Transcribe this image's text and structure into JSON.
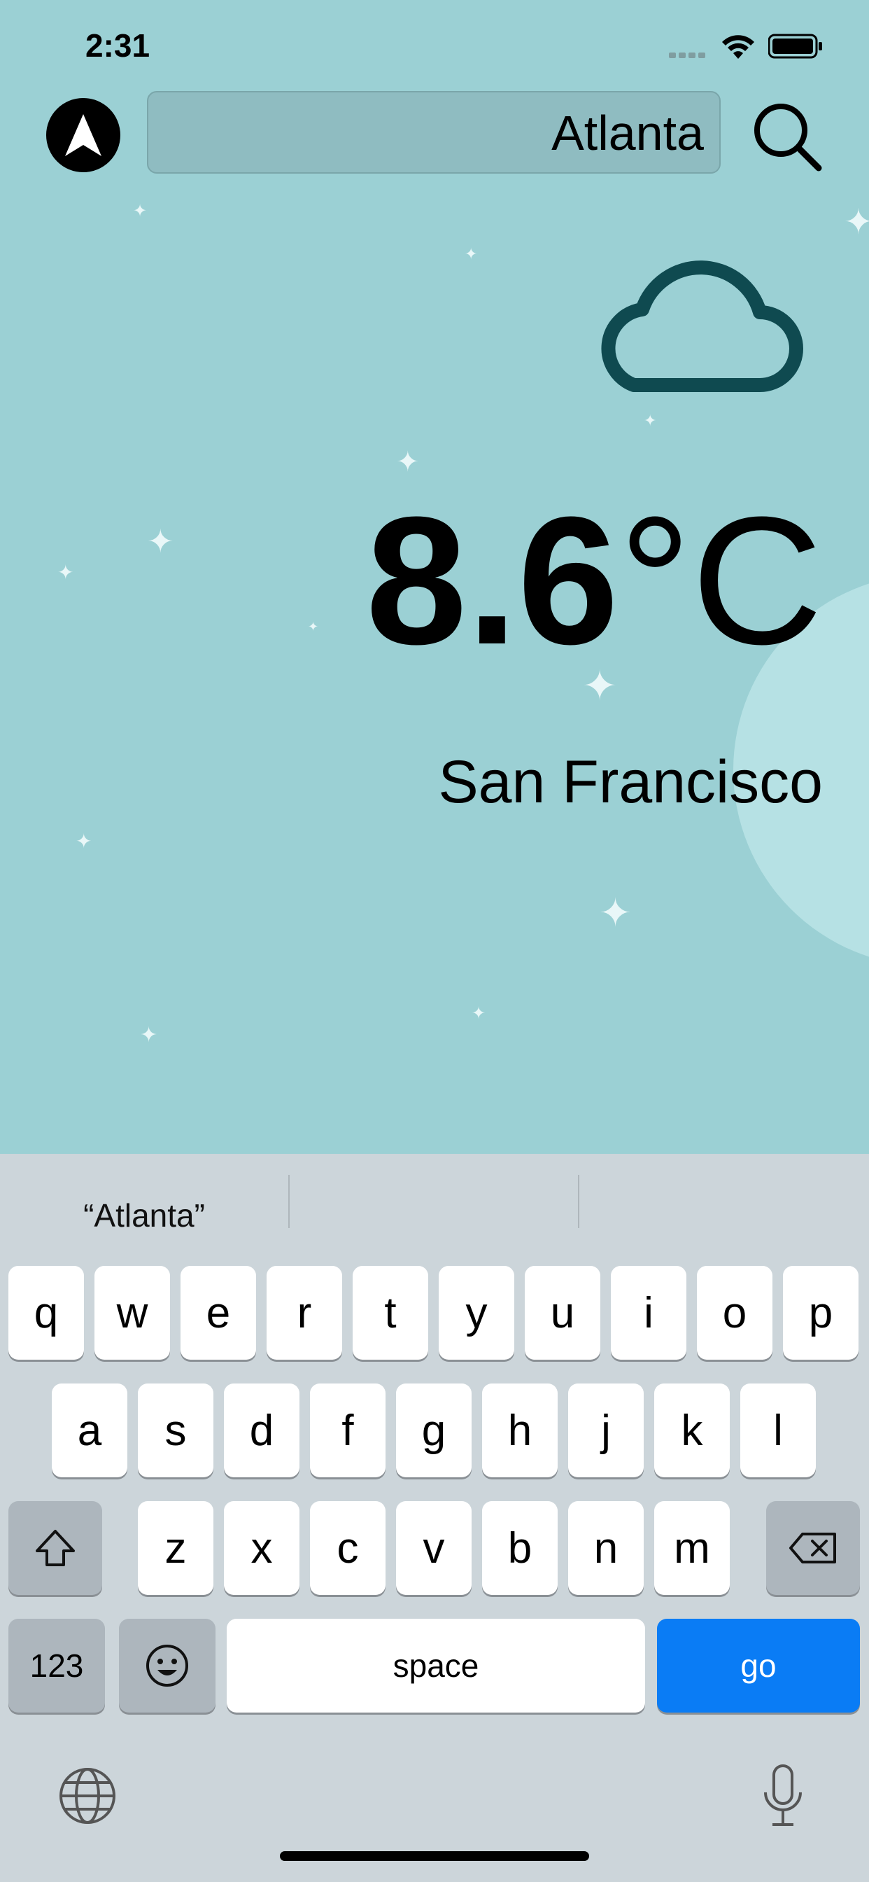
{
  "status_bar": {
    "time": "2:31"
  },
  "search": {
    "value": "Atlanta"
  },
  "weather": {
    "icon": "cloud-icon",
    "temp_value": "8.6",
    "temp_unit": "°C",
    "city": "San Francisco"
  },
  "keyboard": {
    "suggestions": [
      "“Atlanta”",
      "",
      ""
    ],
    "rows": [
      [
        "q",
        "w",
        "e",
        "r",
        "t",
        "y",
        "u",
        "i",
        "o",
        "p"
      ],
      [
        "a",
        "s",
        "d",
        "f",
        "g",
        "h",
        "j",
        "k",
        "l"
      ],
      [
        "z",
        "x",
        "c",
        "v",
        "b",
        "n",
        "m"
      ]
    ],
    "numbers_label": "123",
    "space_label": "space",
    "go_label": "go"
  },
  "colors": {
    "background": "#9bd0d4",
    "cloud": "#0f4a50",
    "go_key": "#0a7cf5",
    "keyboard_bg": "#ccd5da"
  }
}
